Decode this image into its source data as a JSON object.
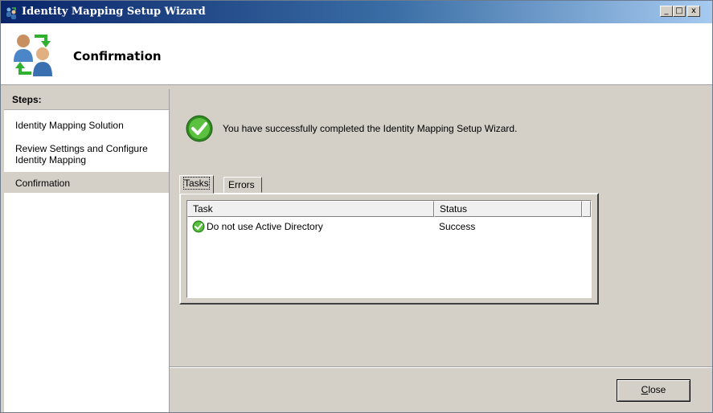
{
  "window": {
    "title": "Identity Mapping Setup Wizard"
  },
  "window_controls": {
    "minimize": "_",
    "maximize": "□",
    "close": "x"
  },
  "header": {
    "title": "Confirmation"
  },
  "steps": {
    "heading": "Steps:",
    "items": [
      {
        "label": "Identity Mapping Solution"
      },
      {
        "label": "Review Settings and Configure Identity Mapping"
      },
      {
        "label": "Confirmation"
      }
    ]
  },
  "main": {
    "message": "You have successfully completed the Identity Mapping Setup Wizard.",
    "tabs": [
      {
        "label": "Tasks"
      },
      {
        "label": "Errors"
      }
    ],
    "table": {
      "columns": [
        "Task",
        "Status"
      ],
      "rows": [
        {
          "task": "Do not use Active Directory",
          "status": "Success"
        }
      ]
    }
  },
  "footer": {
    "close_mnemonic": "C",
    "close_rest": "lose"
  },
  "colors": {
    "titlebar_start": "#0a246a",
    "titlebar_end": "#a6caf0",
    "success_green": "#3c9a2c",
    "face": "#d4d0c8"
  },
  "icons": [
    "app-icon",
    "wizard-users-icon",
    "success-check-icon",
    "row-success-icon"
  ]
}
